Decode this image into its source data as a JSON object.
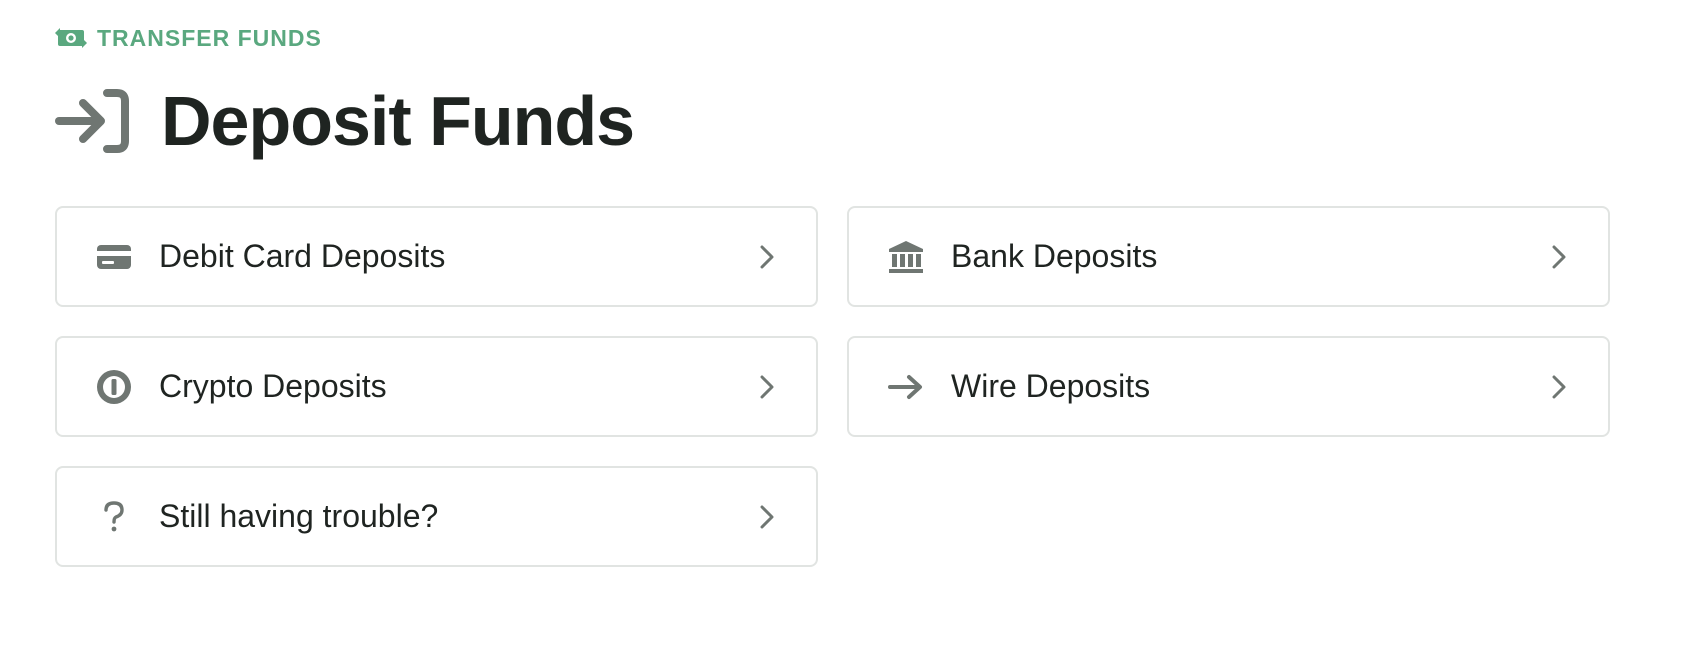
{
  "header": {
    "eyebrow_label": "TRANSFER FUNDS",
    "eyebrow_icon": "money-transfer-icon",
    "title": "Deposit Funds",
    "title_icon": "sign-in-icon"
  },
  "colors": {
    "accent_green": "#5aa87f",
    "icon_gray": "#6f7672",
    "text_dark": "#1f2421",
    "card_border": "#e1e4e2"
  },
  "options": [
    {
      "label": "Debit Card Deposits",
      "icon": "credit-card-icon"
    },
    {
      "label": "Bank Deposits",
      "icon": "bank-icon"
    },
    {
      "label": "Crypto Deposits",
      "icon": "crypto-coin-icon"
    },
    {
      "label": "Wire Deposits",
      "icon": "arrow-right-icon"
    },
    {
      "label": "Still having trouble?",
      "icon": "question-icon"
    }
  ]
}
